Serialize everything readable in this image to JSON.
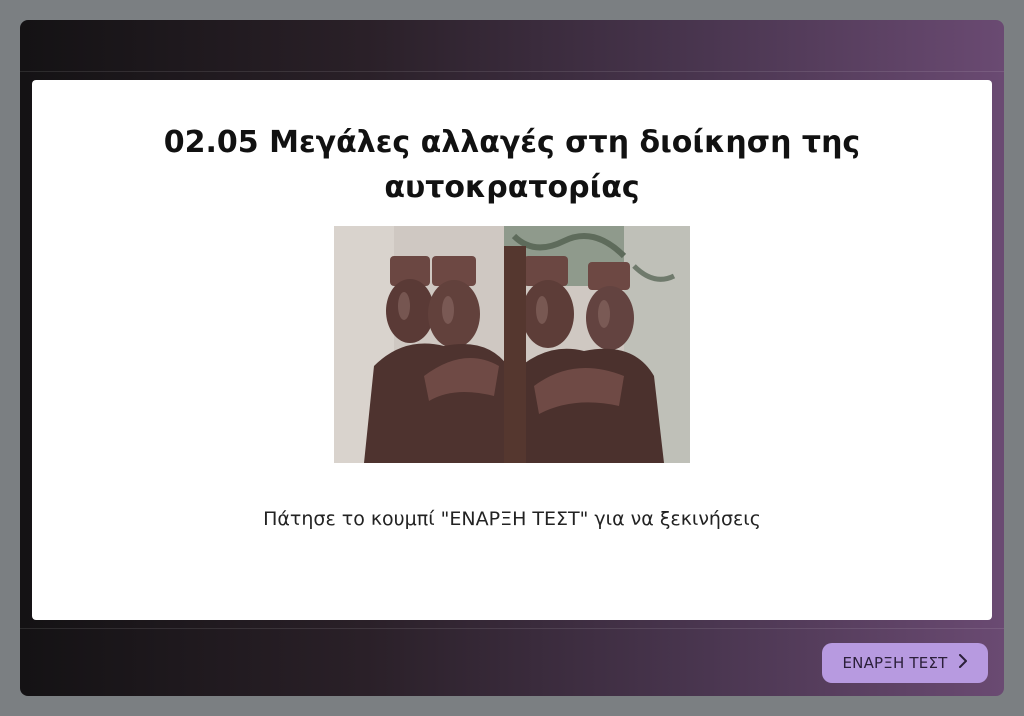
{
  "slide": {
    "title_line1": "02.05 Μεγάλες αλλαγές στη διοίκηση της",
    "title_line2": "αυτοκρατορίας",
    "instruction": "Πάτησε το κουμπί \"ΕΝΑΡΞΗ ΤΕΣΤ\" για να ξεκινήσεις"
  },
  "footer": {
    "start_label": "ΕΝΑΡΞΗ ΤΕΣΤ",
    "start_icon": "chevron-right-icon"
  },
  "colors": {
    "button_bg": "#b79ae0",
    "card_bg": "#ffffff",
    "frame_gradient_end": "#6a4a72"
  }
}
